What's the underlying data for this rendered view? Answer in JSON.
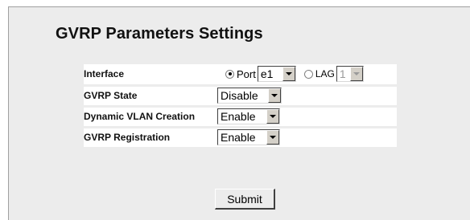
{
  "page": {
    "title": "GVRP Parameters Settings"
  },
  "form": {
    "interface": {
      "label": "Interface",
      "port_option_label": "Port",
      "port_selected": "e1",
      "port_checked": true,
      "lag_option_label": "LAG",
      "lag_selected": "1",
      "lag_checked": false
    },
    "gvrp_state": {
      "label": "GVRP State",
      "value": "Disable"
    },
    "dynamic_vlan_creation": {
      "label": "Dynamic VLAN Creation",
      "value": "Enable"
    },
    "gvrp_registration": {
      "label": "GVRP Registration",
      "value": "Enable"
    }
  },
  "actions": {
    "submit_label": "Submit"
  },
  "colors": {
    "panel_background": "#ececec",
    "row_background": "#ffffff"
  }
}
